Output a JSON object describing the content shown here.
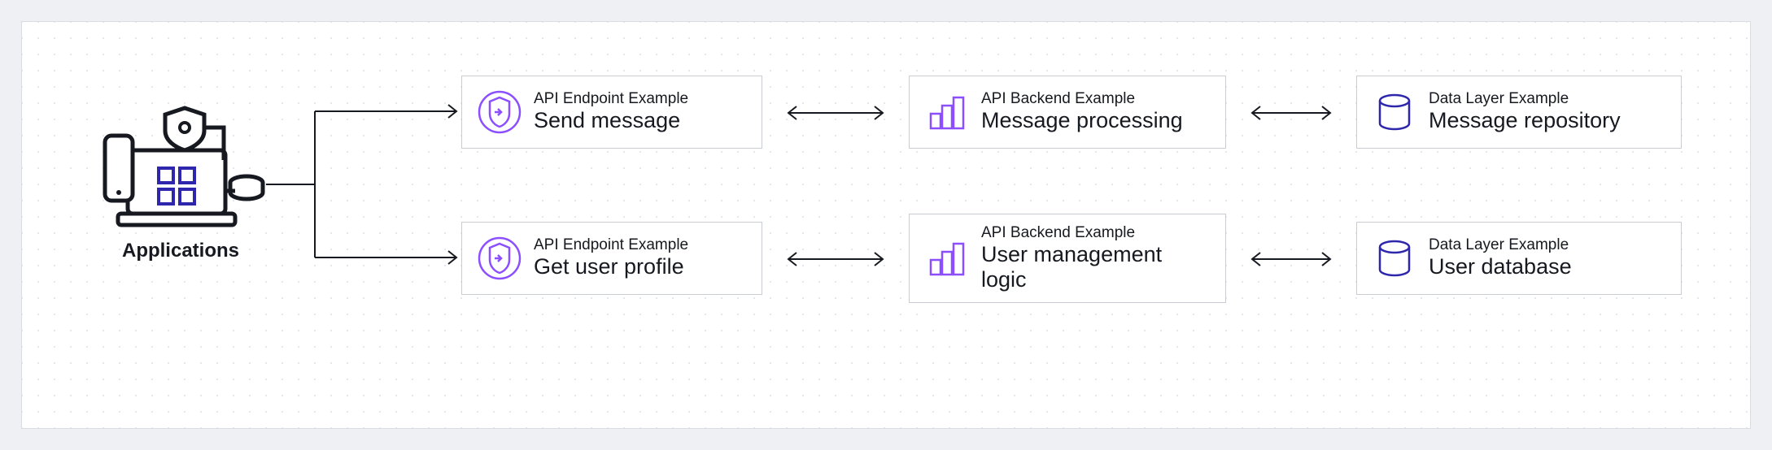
{
  "applications_label": "Applications",
  "rows": [
    {
      "endpoint": {
        "caption": "API Endpoint Example",
        "title": "Send message"
      },
      "backend": {
        "caption": "API Backend Example",
        "title": "Message processing"
      },
      "data": {
        "caption": "Data Layer Example",
        "title": "Message repository"
      }
    },
    {
      "endpoint": {
        "caption": "API Endpoint Example",
        "title": "Get user profile"
      },
      "backend": {
        "caption": "API Backend Example",
        "title": "User management logic"
      },
      "data": {
        "caption": "Data Layer Example",
        "title": "User database"
      }
    }
  ],
  "colors": {
    "endpoint_icon": "#8c4fff",
    "backend_icon": "#8c4fff",
    "data_icon": "#2e27ad"
  }
}
